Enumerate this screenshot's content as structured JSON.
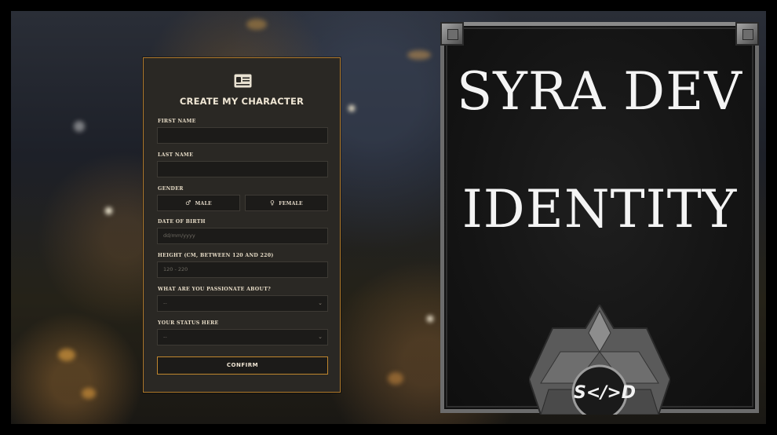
{
  "form": {
    "title": "CREATE MY CHARACTER",
    "first_name_label": "FIRST NAME",
    "first_name_value": "",
    "last_name_label": "LAST NAME",
    "last_name_value": "",
    "gender_label": "GENDER",
    "gender_options": [
      {
        "symbol": "♂",
        "label": "MALE"
      },
      {
        "symbol": "♀",
        "label": "FEMALE"
      }
    ],
    "dob_label": "DATE OF BIRTH",
    "dob_placeholder": "dd/mm/yyyy",
    "height_label": "HEIGHT (CM, BETWEEN 120 AND 220)",
    "height_placeholder": "120 - 220",
    "passion_label": "WHAT ARE YOU PASSIONATE ABOUT?",
    "passion_value": "--",
    "status_label": "YOUR STATUS HERE",
    "status_value": "--",
    "confirm_label": "CONFIRM",
    "icon": "id-card-icon"
  },
  "panel": {
    "line1": "SYRA DEV",
    "line2": "IDENTITY",
    "logo_text": "S</>D"
  },
  "colors": {
    "accent": "#b07a2c",
    "card_bg": "#2a2824",
    "field_bg": "#1c1b19"
  }
}
